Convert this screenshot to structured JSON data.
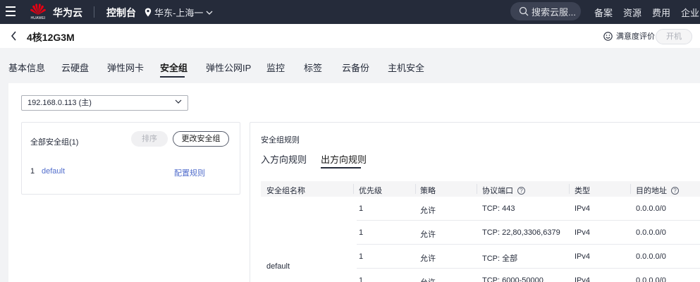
{
  "topbar": {
    "logo_text": "HUAWEI",
    "brand": "华为云",
    "console": "控制台",
    "region": "华东-上海一",
    "search_placeholder": "搜索云服...",
    "links": [
      "备案",
      "资源",
      "费用",
      "企业"
    ]
  },
  "titlebar": {
    "title": "4核12G3M",
    "satisfaction": "满意度评价",
    "power_button": "开机"
  },
  "tabs": [
    {
      "label": "基本信息",
      "active": false
    },
    {
      "label": "云硬盘",
      "active": false
    },
    {
      "label": "弹性网卡",
      "active": false
    },
    {
      "label": "安全组",
      "active": true
    },
    {
      "label": "弹性公网IP",
      "active": false
    },
    {
      "label": "监控",
      "active": false
    },
    {
      "label": "标签",
      "active": false
    },
    {
      "label": "云备份",
      "active": false
    },
    {
      "label": "主机安全",
      "active": false
    }
  ],
  "nic_select": {
    "value": "192.168.0.113 (主)"
  },
  "sg_list": {
    "title": "全部安全组(1)",
    "sort_button": "排序",
    "change_button": "更改安全组",
    "items": [
      {
        "index": "1",
        "name": "default",
        "action": "配置规则"
      }
    ]
  },
  "rules": {
    "title": "安全组规则",
    "tabs": [
      {
        "label": "入方向规则",
        "active": false
      },
      {
        "label": "出方向规则",
        "active": true
      }
    ],
    "columns": [
      "安全组名称",
      "优先级",
      "策略",
      "协议端口",
      "类型",
      "目的地址"
    ],
    "group_name": "default",
    "rows": [
      {
        "priority": "1",
        "policy": "允许",
        "port": "TCP: 443",
        "type": "IPv4",
        "dest": "0.0.0.0/0"
      },
      {
        "priority": "1",
        "policy": "允许",
        "port": "TCP: 22,80,3306,6379",
        "type": "IPv4",
        "dest": "0.0.0.0/0"
      },
      {
        "priority": "1",
        "policy": "允许",
        "port": "TCP: 全部",
        "type": "IPv4",
        "dest": "0.0.0.0/0"
      },
      {
        "priority": "1",
        "policy": "允许",
        "port": "TCP: 6000-50000",
        "type": "IPv4",
        "dest": "0.0.0.0/0"
      }
    ]
  },
  "colors": {
    "topbar_bg": "#252b3a",
    "link": "#526ecc",
    "logo_red": "#e60012"
  }
}
